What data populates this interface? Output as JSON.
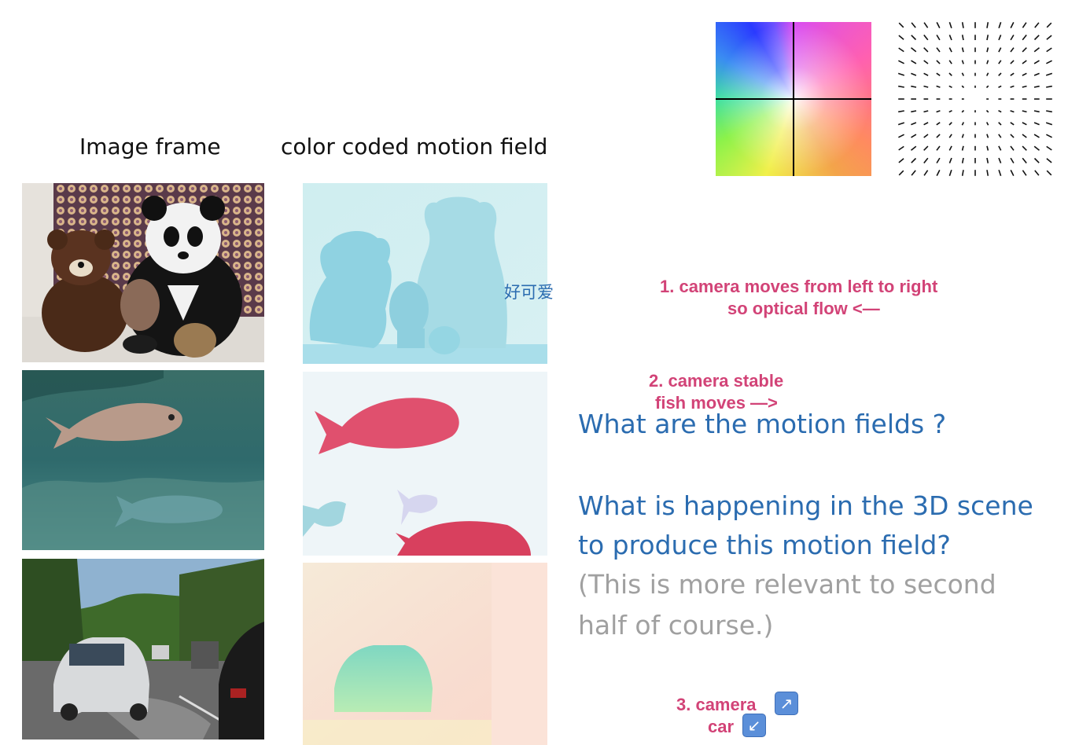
{
  "headers": {
    "image_frame": "Image frame",
    "motion_field": "color coded motion field"
  },
  "annotation_chinese": "好可爱",
  "notes": {
    "note1_line1": "1. camera moves from left to right",
    "note1_line2": "so optical flow <—",
    "note2_line1": "2. camera stable",
    "note2_line2": "fish moves —>",
    "note3_line1": "3. camera",
    "note3_line2": "car"
  },
  "questions": {
    "q1": "What are the motion fields ?",
    "q2_line1": "What is happening in the 3D scene",
    "q2_line2": "to produce this motion field?",
    "aside_line1": "(This is more relevant to second",
    "aside_line2": "half of course.)"
  },
  "icons": {
    "arrow_up_right": "↗",
    "arrow_down_left": "↙"
  },
  "colors": {
    "note_pink": "#d24377",
    "question_blue": "#2b6cb0",
    "aside_gray": "#a0a0a0"
  }
}
